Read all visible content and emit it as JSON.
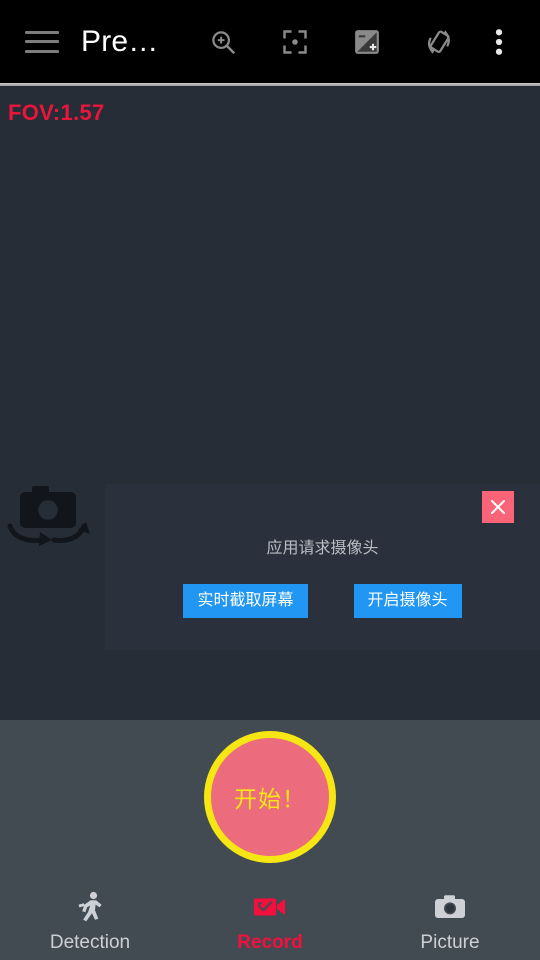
{
  "topbar": {
    "menu_icon": "hamburger-menu-icon",
    "title": "Pre…",
    "actions": [
      {
        "name": "zoom-in-icon",
        "label": "Zoom"
      },
      {
        "name": "focus-icon",
        "label": "Focus"
      },
      {
        "name": "exposure-icon",
        "label": "Exposure"
      },
      {
        "name": "screen-rotation-icon",
        "label": "Screen rotation"
      },
      {
        "name": "overflow-menu-icon",
        "label": "More options"
      }
    ]
  },
  "preview": {
    "fov_text": "FOV:1.57",
    "fov_color": "#e8153c",
    "switch_camera_icon": "switch-camera-icon",
    "background_color": "#262d36"
  },
  "dialog": {
    "message": "应用请求摄像头",
    "close_label": "×",
    "close_color": "#fa6478",
    "button_color": "#2196f3",
    "buttons": [
      {
        "label": "实时截取屏幕"
      },
      {
        "label": "开启摄像头"
      }
    ]
  },
  "bottom": {
    "background_color": "#424a52",
    "record_button": {
      "label": "开始！",
      "fill_color": "#ec6b7d",
      "ring_color": "#f5e614",
      "text_color": "#f5e614"
    },
    "tabs": [
      {
        "label": "Detection",
        "icon": "running-person-icon",
        "active": false
      },
      {
        "label": "Record",
        "icon": "video-camera-check-icon",
        "active": true
      },
      {
        "label": "Picture",
        "icon": "camera-icon",
        "active": false
      }
    ],
    "active_tab_color": "#f50f3f",
    "inactive_tab_color": "#cdd0d4"
  }
}
